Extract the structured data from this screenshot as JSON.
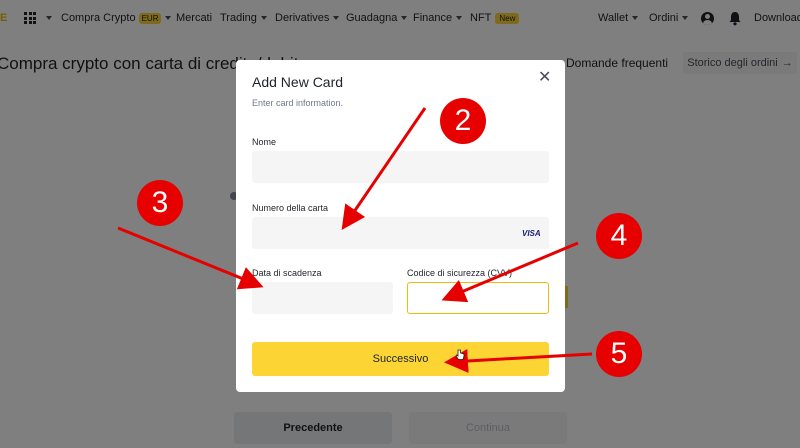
{
  "nav": {
    "logo_fragment": "E",
    "items": [
      "Compra Crypto",
      "Mercati",
      "Trading",
      "Derivatives",
      "Guadagna",
      "Finance",
      "NFT"
    ],
    "eur_badge": "EUR",
    "new_badge": "New",
    "wallet": "Wallet",
    "orders": "Ordini",
    "download": "Download"
  },
  "page": {
    "title": "Compra crypto con carta di credito/debito",
    "faq": "Domande frequenti",
    "order_history": "Storico degli ordini",
    "prev_button": "Precedente",
    "continue_button": "Continua"
  },
  "modal": {
    "title": "Add New Card",
    "subtitle": "Enter card information.",
    "close_icon": "close-icon",
    "name_label": "Nome",
    "card_number_label": "Numero della carta",
    "card_brand": "VISA",
    "expiry_label": "Data di scadenza",
    "cvv_label": "Codice di sicurezza (CVV)",
    "submit_button": "Successivo"
  },
  "annotations": {
    "markers": [
      "2",
      "3",
      "4",
      "5"
    ],
    "color": "#e60000"
  },
  "colors": {
    "accent": "#fcd535",
    "overlay": "rgba(0,0,0,0.5)"
  }
}
